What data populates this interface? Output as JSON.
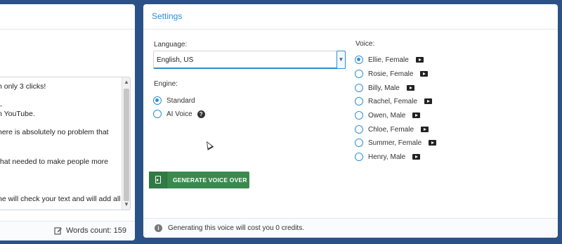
{
  "editor": {
    "lines": [
      "h only 3 clicks!",
      "_",
      "n YouTube.",
      "here is absolutely no problem that",
      "that needed to make people more",
      "ne will check your text and will add all"
    ],
    "words_count_label": "Words count: 159"
  },
  "settings": {
    "title": "Settings",
    "language_label": "Language:",
    "language_value": "English, US",
    "engine_label": "Engine:",
    "engines": [
      {
        "label": "Standard",
        "checked": true
      },
      {
        "label": "AI Voice",
        "checked": false
      }
    ],
    "voice_label": "Voice:",
    "voices": [
      {
        "label": "Ellie, Female",
        "checked": true
      },
      {
        "label": "Rosie, Female",
        "checked": false
      },
      {
        "label": "Billy, Male",
        "checked": false
      },
      {
        "label": "Rachel, Female",
        "checked": false
      },
      {
        "label": "Owen, Male",
        "checked": false
      },
      {
        "label": "Chloe, Female",
        "checked": false
      },
      {
        "label": "Summer, Female",
        "checked": false
      },
      {
        "label": "Henry, Male",
        "checked": false
      }
    ],
    "generate_button": "GENERATE VOICE OVER",
    "footer_info": "Generating this voice will cost you 0 credits."
  },
  "colors": {
    "background": "#2a5286",
    "accent": "#2d8fd5",
    "button_green": "#3a8a4e"
  },
  "icons": {
    "help": "help-icon",
    "play": "play-icon",
    "info": "info-icon",
    "edit": "edit-icon",
    "generate": "document-play-icon"
  }
}
